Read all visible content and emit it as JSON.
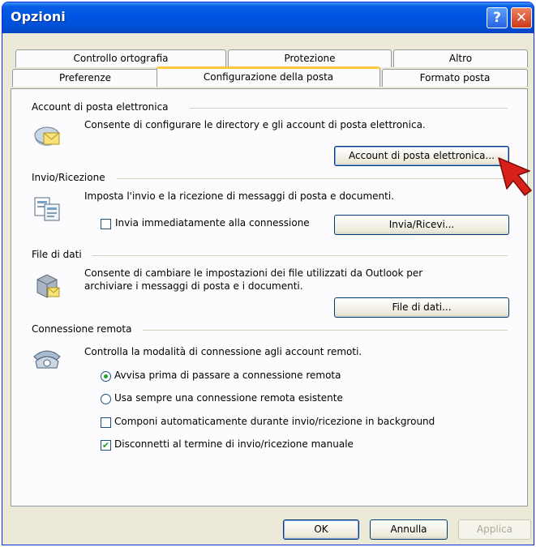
{
  "window": {
    "title": "Opzioni"
  },
  "titlebar": {
    "help_glyph": "?",
    "close_glyph": "✕"
  },
  "tabs": {
    "row_back": [
      "Controllo ortografia",
      "Protezione",
      "Altro"
    ],
    "row_front": [
      "Preferenze",
      "Configurazione della posta",
      "Formato posta"
    ],
    "active": "Configurazione della posta"
  },
  "sections": {
    "accounts": {
      "heading": "Account di posta elettronica",
      "icon": "mail-accounts-icon",
      "description": "Consente di configurare le directory e gli account di posta elettronica.",
      "button": "Account di posta elettronica..."
    },
    "send_receive": {
      "heading": "Invio/Ricezione",
      "icon": "send-receive-icon",
      "description": "Imposta l'invio e la ricezione di messaggi di posta e documenti.",
      "checkbox_label": "Invia immediatamente alla connessione",
      "checkbox_checked": false,
      "button": "Invia/Ricevi..."
    },
    "data_files": {
      "heading": "File di dati",
      "icon": "data-files-icon",
      "description_line1": "Consente di cambiare le impostazioni dei file utilizzati da Outlook per",
      "description_line2": "archiviare i messaggi di posta e i documenti.",
      "button": "File di dati..."
    },
    "dialup": {
      "heading": "Connessione remota",
      "icon": "telephone-icon",
      "description": "Controlla la modalità di connessione agli account remoti.",
      "radio_warn": "Avvisa prima di passare a connessione remota",
      "radio_existing": "Usa sempre una connessione remota esistente",
      "radio_selected": "Avvisa prima di passare a connessione remota",
      "check_autodial": "Componi automaticamente durante invio/ricezione in background",
      "check_autodial_checked": false,
      "check_hangup": "Disconnetti al termine di invio/ricezione manuale",
      "check_hangup_checked": true
    }
  },
  "footer": {
    "ok": "OK",
    "cancel": "Annulla",
    "apply": "Applica"
  },
  "colors": {
    "pointer_arrow": "#d8201a",
    "titlebar": "#0054e3",
    "tab_highlight": "#ffc83c"
  }
}
